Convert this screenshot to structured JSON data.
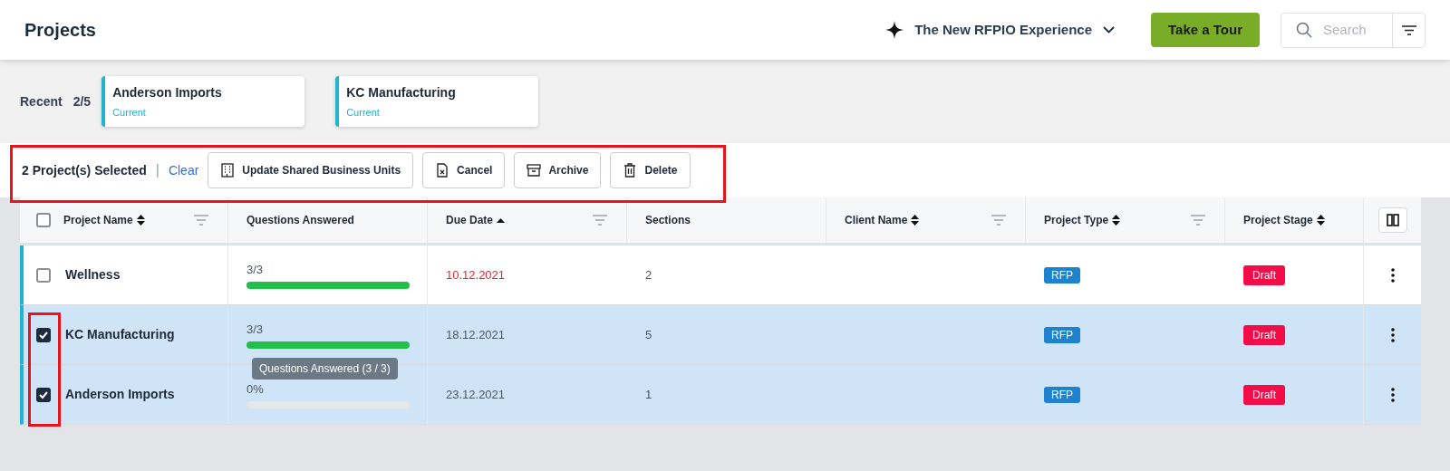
{
  "header": {
    "title": "Projects",
    "experience": "The New RFPIO Experience",
    "tour_button": "Take a Tour",
    "search": {
      "placeholder": "Search"
    }
  },
  "recent": {
    "label": "Recent",
    "count": "2/5",
    "items": [
      {
        "name": "Anderson Imports",
        "status": "Current"
      },
      {
        "name": "KC Manufacturing",
        "status": "Current"
      }
    ]
  },
  "selection_bar": {
    "summary": "2 Project(s) Selected",
    "separator": "|",
    "clear": "Clear",
    "actions": [
      {
        "kind": "units",
        "label": "Update Shared Business Units"
      },
      {
        "kind": "cancel",
        "label": "Cancel"
      },
      {
        "kind": "archive",
        "label": "Archive"
      },
      {
        "kind": "delete",
        "label": "Delete"
      }
    ]
  },
  "table": {
    "all_checked": false,
    "columns": [
      {
        "label": "Project Name",
        "sortable": true,
        "sorted": false,
        "filter": true
      },
      {
        "label": "Questions Answered",
        "sortable": false,
        "sorted": false,
        "filter": false
      },
      {
        "label": "Due Date",
        "sortable": true,
        "sorted": true,
        "filter": true
      },
      {
        "label": "Sections",
        "sortable": false,
        "sorted": false,
        "filter": false
      },
      {
        "label": "Client Name",
        "sortable": true,
        "sorted": false,
        "filter": true
      },
      {
        "label": "Project Type",
        "sortable": true,
        "sorted": false,
        "filter": true
      },
      {
        "label": "Project Stage",
        "sortable": true,
        "sorted": false,
        "filter": false
      }
    ],
    "rows": [
      {
        "checked": false,
        "name": "Wellness",
        "answered": "3/3",
        "level": 1,
        "due": "10.12.2021",
        "overdue": true,
        "sections": "2",
        "type": "RFP",
        "stage": "Draft"
      },
      {
        "checked": true,
        "name": "KC Manufacturing",
        "answered": "3/3",
        "level": 1,
        "due": "18.12.2021",
        "overdue": false,
        "sections": "5",
        "type": "RFP",
        "stage": "Draft"
      },
      {
        "checked": true,
        "name": "Anderson Imports",
        "answered": "0%",
        "level": 0,
        "due": "23.12.2021",
        "overdue": false,
        "sections": "1",
        "type": "RFP",
        "stage": "Draft"
      }
    ]
  },
  "tooltip": "Questions Answered (3 / 3)"
}
